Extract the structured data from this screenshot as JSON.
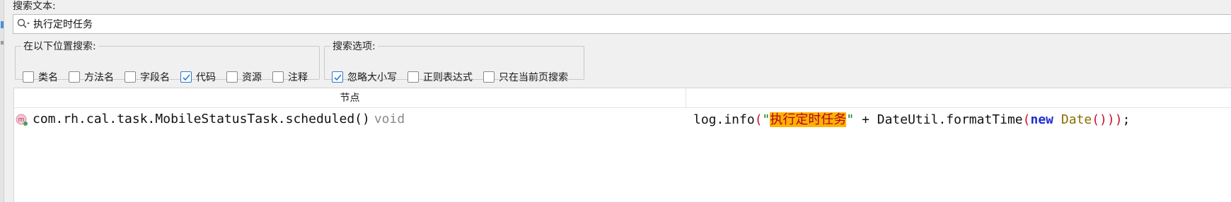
{
  "search": {
    "label": "搜索文本:",
    "value": "执行定时任务"
  },
  "location_group": {
    "legend": "在以下位置搜索:",
    "options": [
      {
        "label": "类名",
        "checked": false
      },
      {
        "label": "方法名",
        "checked": false
      },
      {
        "label": "字段名",
        "checked": false
      },
      {
        "label": "代码",
        "checked": true
      },
      {
        "label": "资源",
        "checked": false
      },
      {
        "label": "注释",
        "checked": false
      }
    ]
  },
  "search_options_group": {
    "legend": "搜索选项:",
    "options": [
      {
        "label": "忽略大小写",
        "checked": true
      },
      {
        "label": "正则表达式",
        "checked": false
      },
      {
        "label": "只在当前页搜索",
        "checked": false
      }
    ]
  },
  "results": {
    "columns": {
      "node": "节点"
    },
    "rows": [
      {
        "icon": "method-icon",
        "node": "com.rh.cal.task.MobileStatusTask.scheduled()",
        "return_type": "void",
        "code": {
          "prefix": "log.info",
          "open_paren": "(",
          "quote_open": "\"",
          "match": "执行定时任务",
          "quote_close": "\"",
          "mid": " + DateUtil.formatTime",
          "open_paren2": "(",
          "kw_new": "new",
          "space": " ",
          "class_date": "Date",
          "parens_end": "()))",
          "semicolon": ";"
        }
      }
    ]
  },
  "colors": {
    "highlight": "#ffb300",
    "check_accent": "#2b79d6"
  }
}
